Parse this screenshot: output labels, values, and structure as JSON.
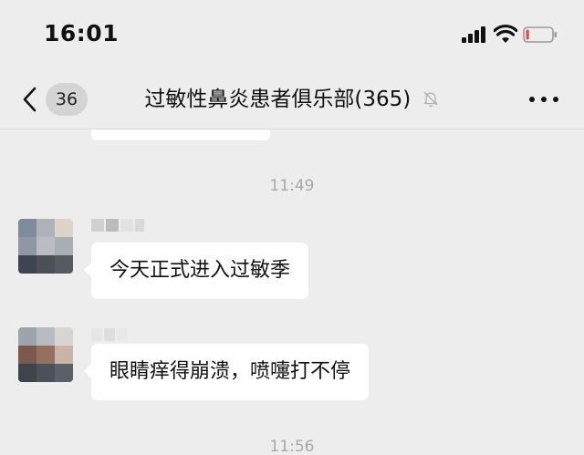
{
  "status_bar": {
    "time": "16:01",
    "icons": [
      "signal-icon",
      "wifi-icon",
      "battery-icon"
    ],
    "battery_level": 0.12,
    "battery_color": "#e5484d"
  },
  "nav": {
    "unread_count": "36",
    "title": "过敏性鼻炎患者俱乐部(365)",
    "icons": [
      "back-icon",
      "mute-bell-icon",
      "more-icon"
    ]
  },
  "messages": {
    "timestamp_1": "11:49",
    "msg_1_text": "今天正式进入过敏季",
    "msg_2_text": "眼睛痒得崩溃，喷嚏打不停",
    "timestamp_2": "11:56"
  },
  "colors": {
    "background": "#ededed",
    "bubble": "#ffffff",
    "timestamp": "#a8a8a8",
    "badge": "#d4d4d4"
  }
}
